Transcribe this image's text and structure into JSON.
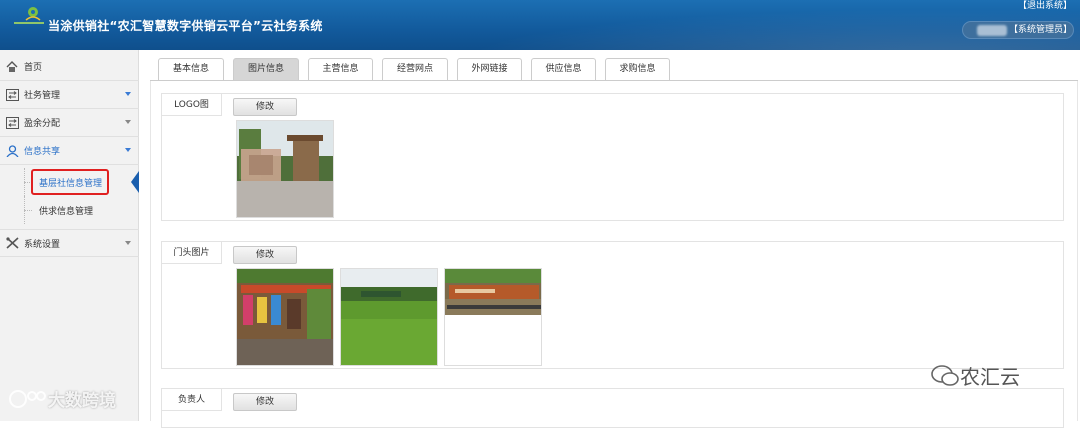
{
  "header": {
    "title": "当涂供销社“农汇智慧数字供销云平台”云社务系统",
    "logout": "【退出系统】",
    "user_role": "【系统管理员】"
  },
  "sidebar": {
    "items": [
      {
        "label": "首页",
        "icon": "home-icon"
      },
      {
        "label": "社务管理",
        "icon": "swap-icon"
      },
      {
        "label": "盈余分配",
        "icon": "swap-icon"
      },
      {
        "label": "信息共享",
        "icon": "user-icon"
      },
      {
        "label": "系统设置",
        "icon": "wrench-icon"
      }
    ],
    "sub_items": [
      {
        "label": "基层社信息管理"
      },
      {
        "label": "供求信息管理"
      }
    ]
  },
  "tabs": [
    "基本信息",
    "图片信息",
    "主营信息",
    "经营网点",
    "外网链接",
    "供应信息",
    "求购信息"
  ],
  "active_tab": "图片信息",
  "sections": [
    {
      "label": "LOGO图",
      "button": "修改"
    },
    {
      "label": "门头图片",
      "button": "修改"
    },
    {
      "label": "负责人",
      "button": "修改"
    }
  ],
  "watermarks": {
    "left": "大数跨境",
    "right": "农汇云"
  },
  "colors": {
    "header_blue": "#125a9c",
    "active_link": "#2a70c8",
    "highlight_red": "#e02020"
  }
}
